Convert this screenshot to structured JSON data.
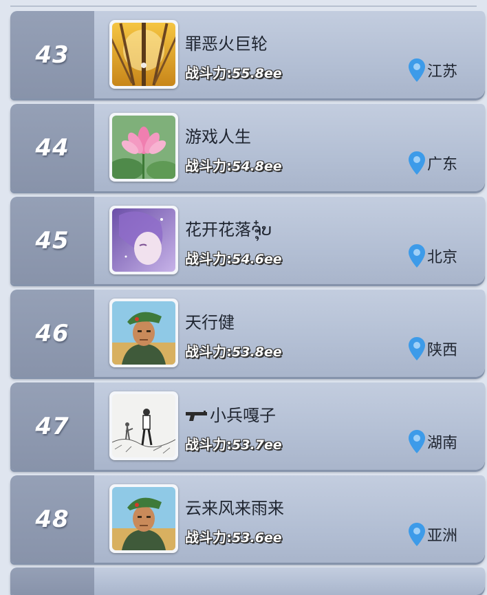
{
  "power_label": "战斗力:",
  "rows": [
    {
      "rank": "43",
      "name": "罪恶火巨轮",
      "power": "55.8ee",
      "location": "江苏",
      "avatar": "autumn-forest"
    },
    {
      "rank": "44",
      "name": "游戏人生",
      "power": "54.8ee",
      "location": "广东",
      "avatar": "pink-lotus"
    },
    {
      "rank": "45",
      "name": "花开花落ຈຸ໋ບ",
      "power": "54.6ee",
      "location": "北京",
      "avatar": "purple-anime-girl"
    },
    {
      "rank": "46",
      "name": "天行健",
      "power": "53.8ee",
      "location": "陕西",
      "avatar": "soldier-green-beret"
    },
    {
      "rank": "47",
      "name": "小兵嘎子",
      "power": "53.7ee",
      "location": "湖南",
      "avatar": "sketch-soldiers",
      "name_icon": "pistol-icon"
    },
    {
      "rank": "48",
      "name": "云来风来雨来",
      "power": "53.6ee",
      "location": "亚洲",
      "avatar": "soldier-green-beret"
    }
  ],
  "colors": {
    "row_bg": "#b3bfd4",
    "rank_bg": "#8893aa",
    "pin": "#3d9be9"
  }
}
